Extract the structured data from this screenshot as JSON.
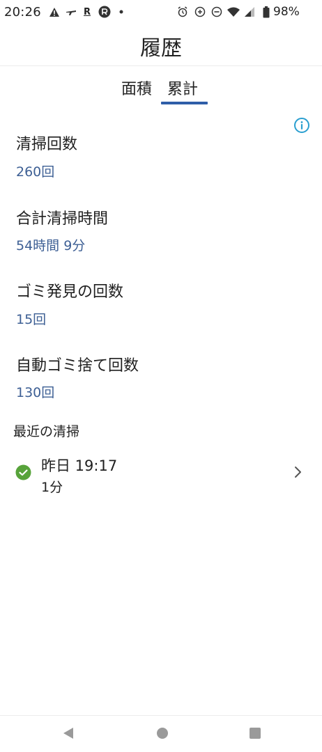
{
  "status_bar": {
    "time": "20:26",
    "left_icons": [
      "warning-icon",
      "airline-icon",
      "r-letter-icon",
      "circle-r-icon",
      "dot-icon"
    ],
    "r_letter": "R",
    "right_icons": [
      "alarm-icon",
      "sync-icon",
      "dnd-icon",
      "wifi-icon",
      "signal-icon",
      "battery-icon"
    ],
    "battery": "98%"
  },
  "header": {
    "title": "履歴"
  },
  "tabs": [
    {
      "label": "面積",
      "selected": false
    },
    {
      "label": "累計",
      "selected": true
    }
  ],
  "stats": [
    {
      "label": "清掃回数",
      "value": "260回"
    },
    {
      "label": "合計清掃時間",
      "value": "54時間 9分"
    },
    {
      "label": "ゴミ発見の回数",
      "value": "15回"
    },
    {
      "label": "自動ゴミ捨て回数",
      "value": "130回"
    }
  ],
  "recent": {
    "heading": "最近の清掃",
    "items": [
      {
        "date": "昨日 19:17",
        "duration": "1分",
        "status": "completed"
      }
    ]
  },
  "colors": {
    "accent": "#2f5ea8",
    "value_text": "#3d5f94",
    "info_icon": "#2a9fd0",
    "success": "#57a33a"
  }
}
